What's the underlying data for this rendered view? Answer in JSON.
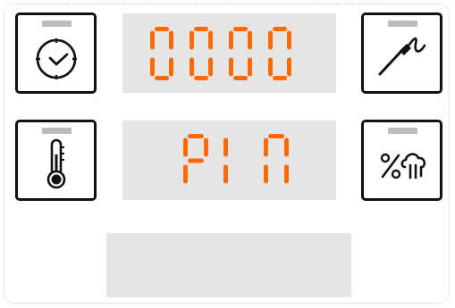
{
  "panel": {
    "buttons": {
      "timer": {
        "icon": "clock-icon"
      },
      "probe": {
        "icon": "meat-probe-icon"
      },
      "temperature": {
        "icon": "thermometer-icon"
      },
      "humidity": {
        "icon": "humidity-percent-icon"
      }
    },
    "displays": {
      "top": {
        "text": "0000",
        "color": "#ff6a00"
      },
      "middle": {
        "text": "PIN",
        "color": "#ff6a00"
      },
      "bottom": {
        "text": ""
      }
    }
  }
}
